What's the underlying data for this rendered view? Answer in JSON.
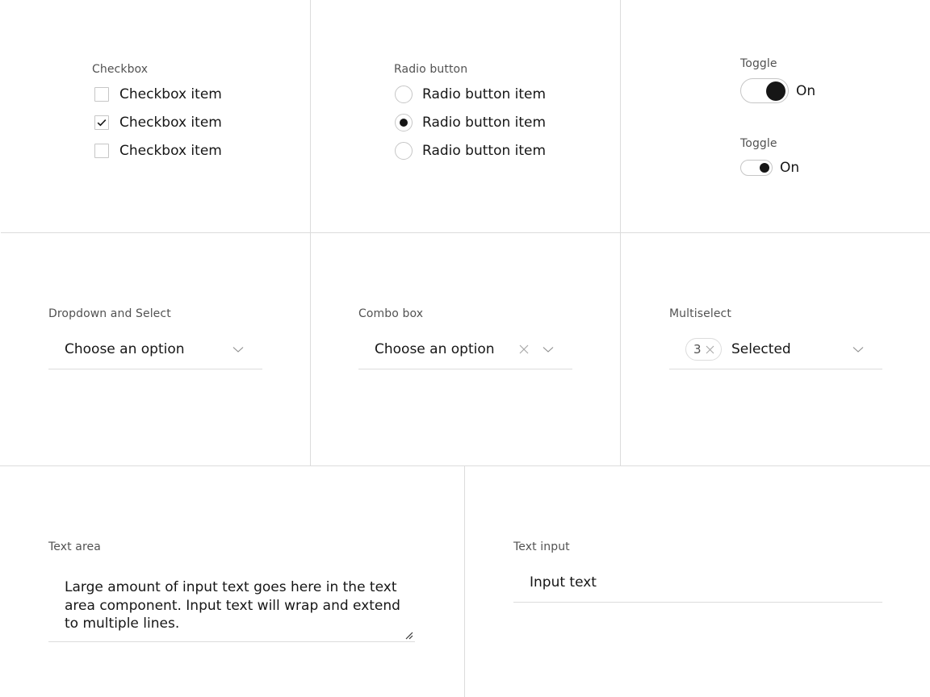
{
  "checkbox": {
    "label": "Checkbox",
    "items": [
      {
        "label": "Checkbox item",
        "checked": false
      },
      {
        "label": "Checkbox item",
        "checked": true
      },
      {
        "label": "Checkbox item",
        "checked": false
      }
    ]
  },
  "radio": {
    "label": "Radio button",
    "items": [
      {
        "label": "Radio button item",
        "selected": false
      },
      {
        "label": "Radio button item",
        "selected": true
      },
      {
        "label": "Radio button item",
        "selected": false
      }
    ]
  },
  "toggles": [
    {
      "label": "Toggle",
      "state_text": "On",
      "on": true,
      "size": "default"
    },
    {
      "label": "Toggle",
      "state_text": "On",
      "on": true,
      "size": "small"
    }
  ],
  "dropdown": {
    "label": "Dropdown and Select",
    "value": "Choose an option",
    "icon": "chevron-down-icon"
  },
  "combobox": {
    "label": "Combo box",
    "value": "Choose an option",
    "clear_icon": "close-icon",
    "icon": "chevron-down-icon"
  },
  "multiselect": {
    "label": "Multiselect",
    "selected_count": "3",
    "value": "Selected",
    "clear_icon": "close-icon",
    "icon": "chevron-down-icon"
  },
  "textarea": {
    "label": "Text area",
    "value": "Large amount of input text goes here in the text area component. Input text will wrap and extend to multiple lines.",
    "resize_icon": "resize-handle-icon"
  },
  "text_input": {
    "label": "Text input",
    "value": "Input text"
  },
  "colors": {
    "text_primary": "#161616",
    "text_secondary": "#525252",
    "border": "#c6c6c6",
    "divider": "#dcdcdc",
    "background": "#ffffff"
  }
}
